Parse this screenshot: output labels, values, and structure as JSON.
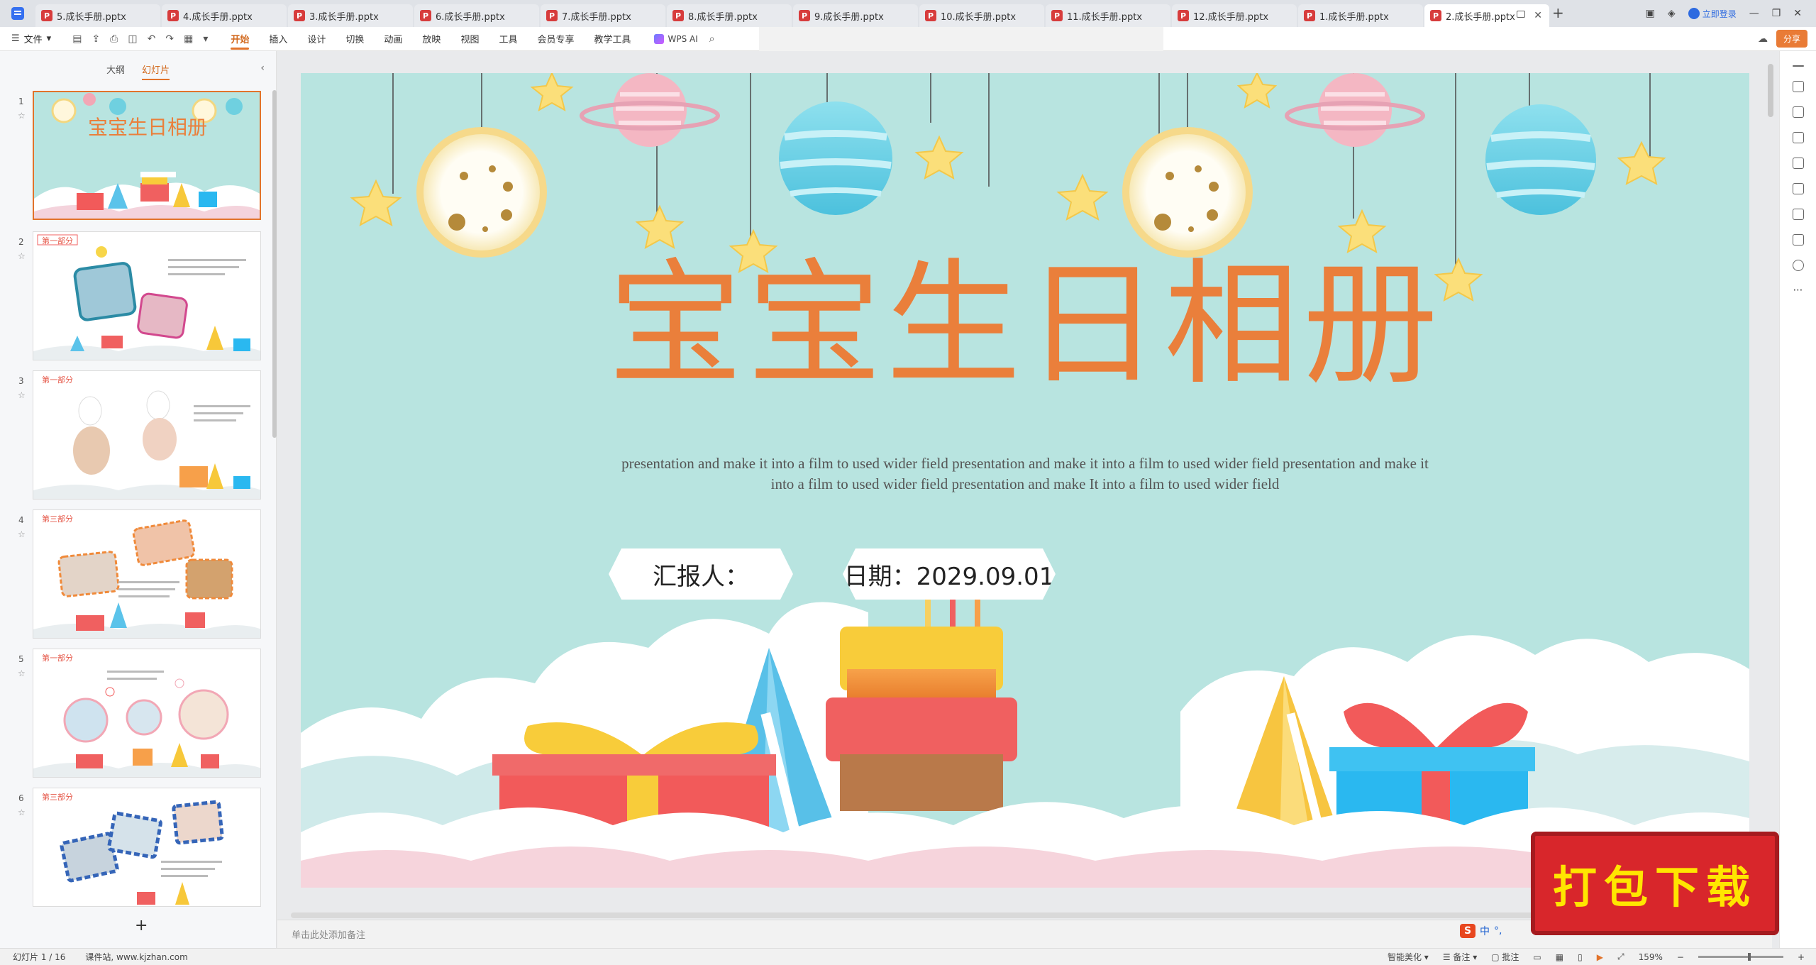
{
  "tabs": [
    {
      "label": "5.成长手册.pptx",
      "active": false
    },
    {
      "label": "4.成长手册.pptx",
      "active": false
    },
    {
      "label": "3.成长手册.pptx",
      "active": false
    },
    {
      "label": "6.成长手册.pptx",
      "active": false
    },
    {
      "label": "7.成长手册.pptx",
      "active": false
    },
    {
      "label": "8.成长手册.pptx",
      "active": false
    },
    {
      "label": "9.成长手册.pptx",
      "active": false
    },
    {
      "label": "10.成长手册.pptx",
      "active": false
    },
    {
      "label": "11.成长手册.pptx",
      "active": false
    },
    {
      "label": "12.成长手册.pptx",
      "active": false
    },
    {
      "label": "1.成长手册.pptx",
      "active": false
    },
    {
      "label": "2.成长手册.pptx",
      "active": true
    }
  ],
  "titlebar": {
    "login": "立即登录",
    "new_tab": "+"
  },
  "ribbon": {
    "file_menu": "文件",
    "tabs": [
      "开始",
      "插入",
      "设计",
      "切换",
      "动画",
      "放映",
      "视图",
      "工具",
      "会员专享",
      "教学工具"
    ],
    "active_tab": "开始",
    "wps_ai": "WPS AI",
    "share": "分享"
  },
  "left_panel": {
    "tab_outline": "大纲",
    "tab_slides": "幻灯片",
    "add": "+",
    "thumbnails": [
      {
        "num": "1",
        "label": "",
        "title": "宝宝生日相册"
      },
      {
        "num": "2",
        "label": "第一部分",
        "title": ""
      },
      {
        "num": "3",
        "label": "第一部分",
        "title": ""
      },
      {
        "num": "4",
        "label": "第三部分",
        "title": ""
      },
      {
        "num": "5",
        "label": "第一部分",
        "title": ""
      },
      {
        "num": "6",
        "label": "第三部分",
        "title": ""
      }
    ]
  },
  "slide": {
    "title": "宝宝生日相册",
    "subtitle_line1": "presentation and make it into a film to used wider field presentation and make it into a film to used wider field presentation and make it",
    "subtitle_line2": "into a film to used wider field presentation and make It into a film to used wider field",
    "reporter": "汇报人：",
    "date": "日期：2029.09.01"
  },
  "notes_placeholder": "单击此处添加备注",
  "status": {
    "slide_info": "幻灯片 1 / 16",
    "site": "课件站, www.kjzhan.com",
    "smart": "智能美化",
    "notes": "备注",
    "comments": "批注",
    "zoom": "159%"
  },
  "promo": "打包下载",
  "ime": {
    "lang": "中"
  },
  "colors": {
    "accent": "#e2732b",
    "title": "#ea7f3b",
    "slide_bg": "#b8e4e0",
    "promo": "#d8262b"
  }
}
